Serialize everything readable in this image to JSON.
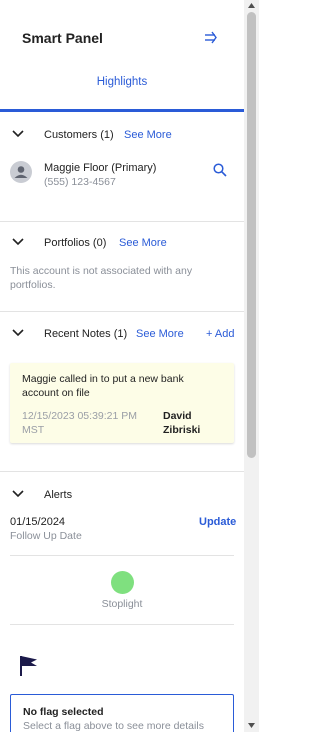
{
  "header": {
    "title": "Smart Panel",
    "collapse_icon": "collapse-right-icon"
  },
  "tabs": [
    {
      "label": "Highlights",
      "active": true
    }
  ],
  "customers": {
    "title": "Customers (1)",
    "see_more": "See More",
    "items": [
      {
        "name": "Maggie Floor (Primary)",
        "phone": "(555) 123-4567"
      }
    ]
  },
  "portfolios": {
    "title": "Portfolios (0)",
    "see_more": "See More",
    "empty_text": "This account is not associated with any portfolios."
  },
  "notes": {
    "title": "Recent Notes (1)",
    "see_more": "See More",
    "add_label": "+ Add",
    "items": [
      {
        "text": "Maggie called in to put a new bank account on file",
        "date": "12/15/2023 05:39:21 PM MST",
        "author": "David Zibriski"
      }
    ]
  },
  "alerts": {
    "title": "Alerts",
    "date": "01/15/2024",
    "label": "Follow Up Date",
    "update_label": "Update"
  },
  "stoplight": {
    "label": "Stoplight",
    "color": "#7fe07f"
  },
  "flag": {
    "icon": "flag-icon",
    "title": "No flag selected",
    "subtitle": "Select a flag above to see more details"
  },
  "colors": {
    "accent": "#2a5bd7",
    "note_bg": "#fdfde7"
  }
}
